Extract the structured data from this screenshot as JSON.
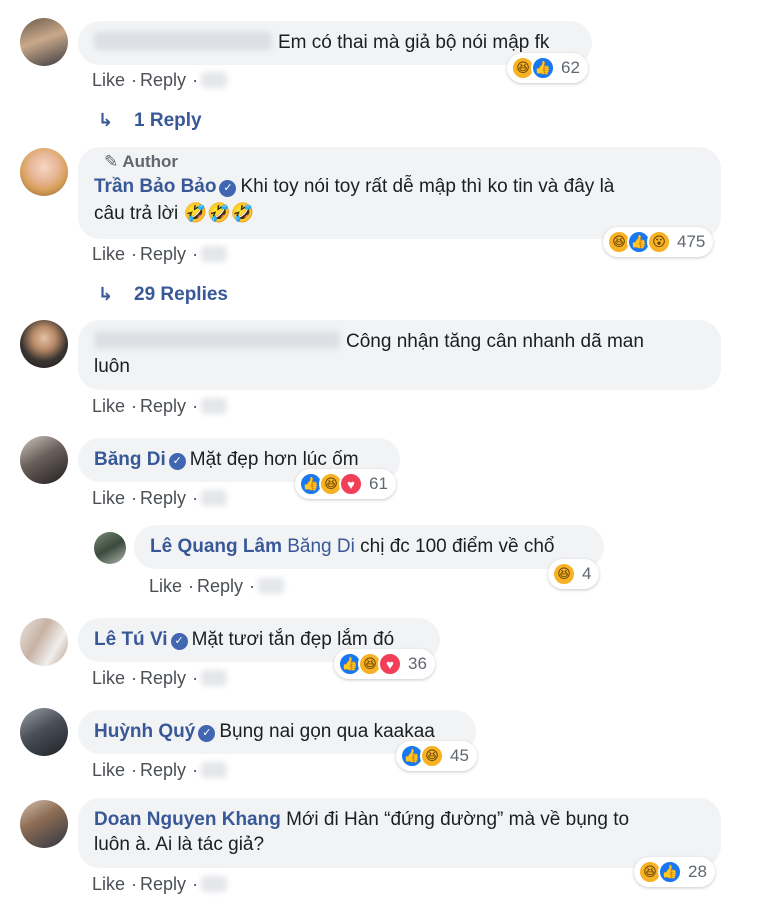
{
  "labels": {
    "like": "Like",
    "reply": "Reply"
  },
  "comments": [
    {
      "text": "Em có thai mà giả bộ nói mập fk",
      "reactions": [
        "haha",
        "like"
      ],
      "count": "62",
      "replies_link": "1 Reply"
    },
    {
      "author_tag": "Author",
      "name": "Trần Bảo Bảo",
      "verified": true,
      "text_line1": "Khi toy nói toy rất dễ mập thì ko tin và đây là",
      "text_line2": "câu trả lời 🤣🤣🤣",
      "reactions": [
        "haha",
        "like",
        "wow"
      ],
      "count": "475",
      "replies_link": "29 Replies"
    },
    {
      "text_line1": "Công nhận tăng cân nhanh dã man",
      "text_line2": "luôn"
    },
    {
      "name": "Băng Di",
      "verified": true,
      "text": "Mặt đẹp hơn lúc ốm",
      "reactions": [
        "like",
        "haha",
        "love"
      ],
      "count": "61"
    },
    {
      "name": "Lê Quang Lâm",
      "mention": "Băng Di",
      "text": "chị đc 100 điểm về chổ",
      "reactions": [
        "haha"
      ],
      "count": "4"
    },
    {
      "name": "Lê Tú Vi",
      "verified": true,
      "text": "Mặt tươi tắn đẹp lắm đó",
      "reactions": [
        "like",
        "haha",
        "love"
      ],
      "count": "36"
    },
    {
      "name": "Huỳnh Quý",
      "verified": true,
      "text": "Bụng nai gọn qua kaakaa",
      "reactions": [
        "like",
        "haha"
      ],
      "count": "45"
    },
    {
      "name": "Doan Nguyen Khang",
      "text_line1": "Mới đi Hàn “đứng đường” mà về bụng to",
      "text_line2": "luôn à. Ai là tác giả?",
      "reactions": [
        "haha",
        "like"
      ],
      "count": "28"
    }
  ],
  "colors": {
    "link": "#385898",
    "bubble": "#f2f3f5",
    "like": "#1877f2",
    "haha": "#f7b125",
    "love": "#f33e58"
  }
}
